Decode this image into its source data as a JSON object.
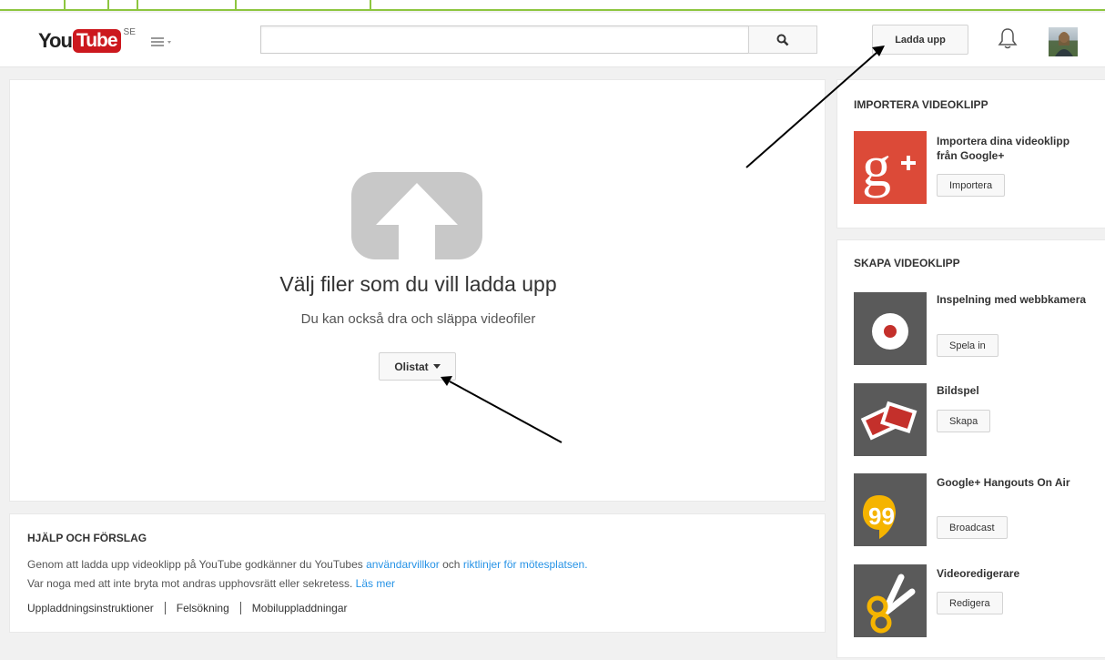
{
  "logo": {
    "you": "You",
    "tube": "Tube",
    "country": "SE"
  },
  "search": {
    "placeholder": ""
  },
  "header": {
    "upload_label": "Ladda upp"
  },
  "upload": {
    "title": "Välj filer som du vill ladda upp",
    "subtitle": "Du kan också dra och släppa videofiler",
    "privacy_label": "Olistat"
  },
  "help": {
    "title": "HJÄLP OCH FÖRSLAG",
    "line1_prefix": "Genom att ladda upp videoklipp på YouTube godkänner du YouTubes ",
    "terms_link": "användarvillkor",
    "line1_mid": " och ",
    "guidelines_link": "riktlinjer för mötesplatsen",
    "line1_suffix": ".",
    "line2_prefix": "Var noga med att inte bryta mot andras upphovsrätt eller sekretess. ",
    "read_more": "Läs mer",
    "links": [
      "Uppladdningsinstruktioner",
      "Felsökning",
      "Mobiluppladdningar"
    ]
  },
  "import": {
    "title": "IMPORTERA VIDEOKLIPP",
    "item_title": "Importera dina videoklipp från Google+",
    "button": "Importera"
  },
  "create": {
    "title": "SKAPA VIDEOKLIPP",
    "items": [
      {
        "title": "Inspelning med webbkamera",
        "button": "Spela in",
        "icon": "record-icon"
      },
      {
        "title": "Bildspel",
        "button": "Skapa",
        "icon": "slideshow-icon"
      },
      {
        "title": "Google+ Hangouts On Air",
        "button": "Broadcast",
        "icon": "hangouts-icon"
      },
      {
        "title": "Videoredigerare",
        "button": "Redigera",
        "icon": "scissors-icon"
      }
    ]
  }
}
